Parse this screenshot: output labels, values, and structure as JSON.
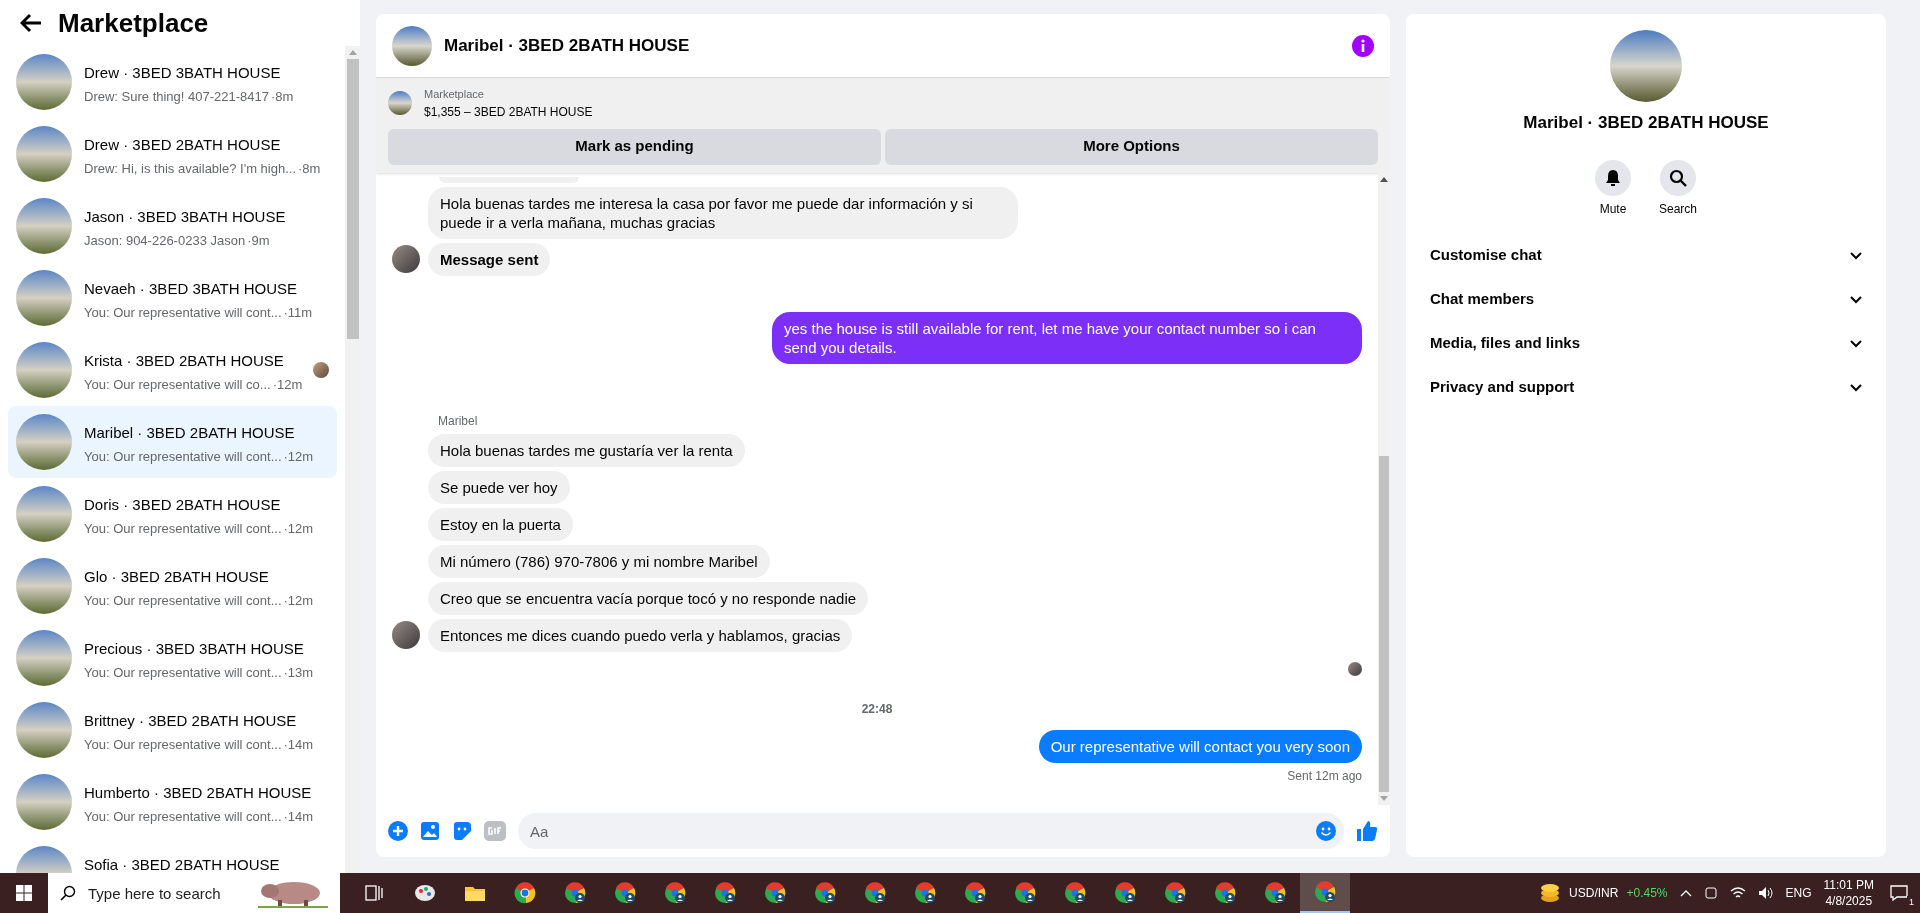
{
  "sidebar": {
    "title": "Marketplace",
    "conversations": [
      {
        "title": "Drew · 3BED 3BATH HOUSE",
        "preview": "Drew: Sure thing! 407-221-8417",
        "time": "·8m",
        "selected": false,
        "read_avatar": false
      },
      {
        "title": "Drew · 3BED 2BATH HOUSE",
        "preview": "Drew: Hi, is this available? I'm high...",
        "time": "·8m",
        "selected": false,
        "read_avatar": false
      },
      {
        "title": "Jason · 3BED 3BATH HOUSE",
        "preview": "Jason: 904-226-0233 Jason",
        "time": "·9m",
        "selected": false,
        "read_avatar": false
      },
      {
        "title": "Nevaeh · 3BED 3BATH HOUSE",
        "preview": "You: Our representative will cont...",
        "time": "·11m",
        "selected": false,
        "read_avatar": false
      },
      {
        "title": "Krista · 3BED 2BATH HOUSE",
        "preview": "You: Our representative will co...",
        "time": "·12m",
        "selected": false,
        "read_avatar": true
      },
      {
        "title": "Maribel · 3BED 2BATH HOUSE",
        "preview": "You: Our representative will cont...",
        "time": "·12m",
        "selected": true,
        "read_avatar": false
      },
      {
        "title": "Doris · 3BED 2BATH HOUSE",
        "preview": "You: Our representative will cont...",
        "time": "·12m",
        "selected": false,
        "read_avatar": false
      },
      {
        "title": "Glo · 3BED 2BATH HOUSE",
        "preview": "You: Our representative will cont...",
        "time": "·12m",
        "selected": false,
        "read_avatar": false
      },
      {
        "title": "Precious · 3BED 3BATH HOUSE",
        "preview": "You: Our representative will cont...",
        "time": "·13m",
        "selected": false,
        "read_avatar": false
      },
      {
        "title": "Brittney · 3BED 2BATH HOUSE",
        "preview": "You: Our representative will cont...",
        "time": "·14m",
        "selected": false,
        "read_avatar": false
      },
      {
        "title": "Humberto · 3BED 2BATH HOUSE",
        "preview": "You: Our representative will cont...",
        "time": "·14m",
        "selected": false,
        "read_avatar": false
      },
      {
        "title": "Sofia · 3BED 2BATH HOUSE",
        "selected": false
      }
    ]
  },
  "chat": {
    "title": "Maribel · 3BED 2BATH HOUSE",
    "listing": {
      "label": "Marketplace",
      "title": "$1,355 – 3BED 2BATH HOUSE"
    },
    "actions": [
      "Mark as pending",
      "More Options"
    ],
    "messages": [
      {
        "kind": "incoming",
        "text": "Hola buenas tardes me interesa la casa por favor me puede dar información y si puede ir a verla mañana, muchas gracias",
        "avatar": false
      },
      {
        "kind": "notice",
        "text": "Message sent",
        "avatar": true
      },
      {
        "kind": "outgoing",
        "text": "yes the house is still available for rent, let me have your contact number so i can send you details.",
        "color": "#7b2ff7"
      },
      {
        "kind": "sender",
        "text": "Maribel"
      },
      {
        "kind": "incoming",
        "text": "Hola buenas tardes me gustaría ver la renta",
        "avatar": false
      },
      {
        "kind": "incoming",
        "text": "Se puede ver hoy",
        "avatar": false
      },
      {
        "kind": "incoming",
        "text": "Estoy en la puerta",
        "avatar": false
      },
      {
        "kind": "incoming",
        "text": "Mi número (786) 970-7806 y mi nombre Maribel",
        "avatar": false
      },
      {
        "kind": "incoming",
        "text": "Creo que se encuentra vacía porque tocó y no responde nadie",
        "avatar": false
      },
      {
        "kind": "incoming",
        "text": "Entonces me dices cuando puedo verla y hablamos, gracias",
        "avatar": true
      },
      {
        "kind": "seen"
      },
      {
        "kind": "time",
        "text": "22:48"
      },
      {
        "kind": "outgoing",
        "text": "Our representative will contact you very soon",
        "color": "#0a7cff"
      },
      {
        "kind": "receipt",
        "text": "Sent 12m ago"
      }
    ],
    "composer": {
      "placeholder": "Aa"
    }
  },
  "details": {
    "title": "Maribel · 3BED 2BATH HOUSE",
    "actions": [
      {
        "kind": "mute",
        "label": "Mute"
      },
      {
        "kind": "search",
        "label": "Search"
      }
    ],
    "sections": [
      {
        "label": "Customise chat",
        "expanded": false
      },
      {
        "label": "Chat members",
        "expanded": false
      },
      {
        "label": "Media, files and links",
        "expanded": false
      },
      {
        "label": "Privacy and support",
        "expanded": false
      }
    ]
  },
  "taskbar": {
    "search_placeholder": "Type here to search",
    "apps": [
      {
        "kind": "task_view",
        "selected": false
      },
      {
        "kind": "paint",
        "selected": false
      },
      {
        "kind": "folder",
        "selected": false
      },
      {
        "kind": "browser",
        "selected": false
      },
      {
        "kind": "profile",
        "selected": false
      },
      {
        "kind": "profile",
        "selected": false
      },
      {
        "kind": "profile",
        "selected": false
      },
      {
        "kind": "profile",
        "selected": false
      },
      {
        "kind": "profile",
        "selected": false
      },
      {
        "kind": "profile",
        "selected": false
      },
      {
        "kind": "profile",
        "selected": false
      },
      {
        "kind": "profile",
        "selected": false
      },
      {
        "kind": "profile",
        "selected": false
      },
      {
        "kind": "profile",
        "selected": false
      },
      {
        "kind": "profile",
        "selected": false
      },
      {
        "kind": "profile",
        "selected": false
      },
      {
        "kind": "profile",
        "selected": false
      },
      {
        "kind": "profile",
        "selected": false
      },
      {
        "kind": "profile",
        "selected": false
      },
      {
        "kind": "profile",
        "selected": true
      }
    ],
    "ticker": {
      "label": "USD/INR",
      "change": "+0.45%"
    },
    "language": "ENG",
    "time": "11:01 PM",
    "date": "4/8/2025",
    "notification_count": "1"
  }
}
